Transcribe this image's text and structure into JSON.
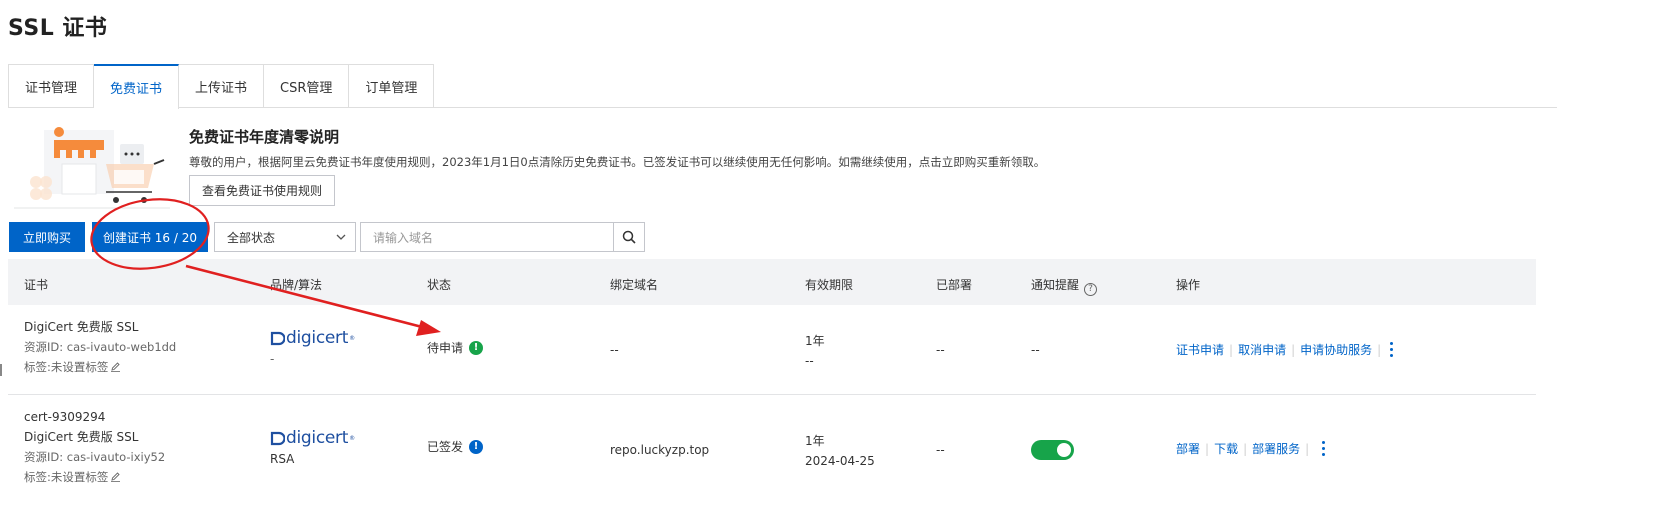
{
  "page": {
    "title": "SSL 证书"
  },
  "tabs": [
    {
      "label": "证书管理"
    },
    {
      "label": "免费证书",
      "active": true
    },
    {
      "label": "上传证书"
    },
    {
      "label": "CSR管理"
    },
    {
      "label": "订单管理"
    }
  ],
  "notice": {
    "title": "免费证书年度清零说明",
    "text": "尊敬的用户，根据阿里云免费证书年度使用规则，2023年1月1日0点清除历史免费证书。已签发证书可以继续使用无任何影响。如需继续使用，点击立即购买重新领取。",
    "button": "查看免费证书使用规则"
  },
  "toolbar": {
    "buy_label": "立即购买",
    "create_label": "创建证书 16 / 20",
    "status_select": "全部状态",
    "search_placeholder": "请输入域名"
  },
  "table": {
    "headers": [
      "证书",
      "品牌/算法",
      "状态",
      "绑定域名",
      "有效期限",
      "已部署",
      "通知提醒",
      "操作"
    ],
    "rows": [
      {
        "name": "DigiCert 免费版 SSL",
        "resource_id": "资源ID: cas-ivauto-web1dd",
        "tag": "标签:未设置标签",
        "brand": "digicert",
        "algorithm": "-",
        "status": "待申请",
        "domain": "--",
        "validity": "1年",
        "expiry": "--",
        "deployed": "--",
        "notify": "--",
        "actions": [
          "证书申请",
          "取消申请",
          "申请协助服务"
        ]
      },
      {
        "cert_id": "cert-9309294",
        "name": "DigiCert 免费版 SSL",
        "resource_id": "资源ID: cas-ivauto-ixiy52",
        "tag": "标签:未设置标签",
        "brand": "digicert",
        "algorithm": "RSA",
        "status": "已签发",
        "domain": "repo.luckyzp.top",
        "validity": "1年",
        "expiry": "2024-04-25",
        "deployed": "--",
        "notify_on": true,
        "actions": [
          "部署",
          "下载",
          "部署服务"
        ]
      }
    ]
  },
  "colors": {
    "primary": "#0064c8",
    "success": "#17a44a",
    "brand_logo": "#1e4fa0",
    "annotation": "#e02020"
  }
}
